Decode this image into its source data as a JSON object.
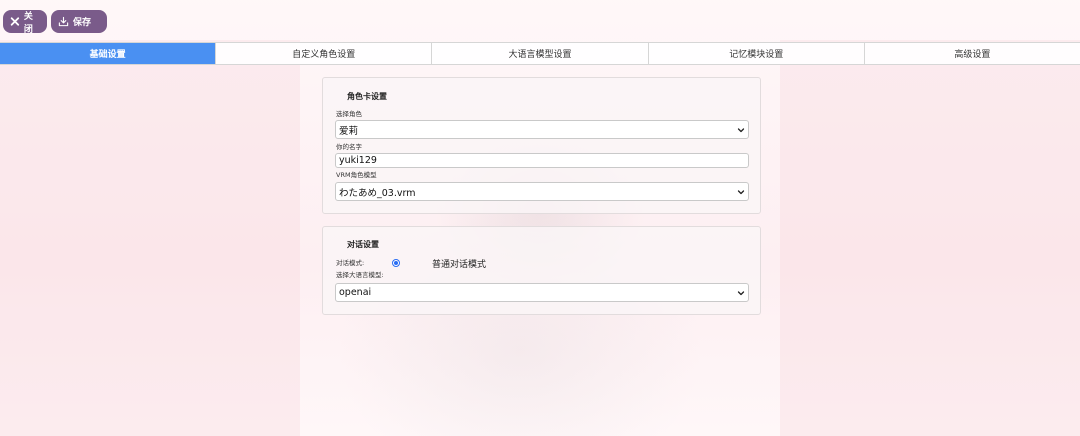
{
  "toolbar": {
    "close_label": "关闭",
    "save_label": "保存"
  },
  "tabs": [
    {
      "label": "基础设置",
      "active": true
    },
    {
      "label": "自定义角色设置",
      "active": false
    },
    {
      "label": "大语言模型设置",
      "active": false
    },
    {
      "label": "记忆模块设置",
      "active": false
    },
    {
      "label": "高级设置",
      "active": false
    }
  ],
  "character_card": {
    "title": "角色卡设置",
    "select_character_label": "选择角色",
    "select_character_value": "爱莉",
    "your_name_label": "你的名字",
    "your_name_value": "yuki129",
    "vrm_model_label": "VRM角色模型",
    "vrm_model_value": "わたあめ_03.vrm"
  },
  "dialogue": {
    "title": "对话设置",
    "mode_label": "对话模式:",
    "mode_option": "普通对话模式",
    "mode_selected": true,
    "llm_label": "选择大语言模型:",
    "llm_value": "openai"
  },
  "colors": {
    "accent_tab": "#4a90f2",
    "toolbar_button": "#7a5b8a",
    "radio": "#2a6df4"
  }
}
